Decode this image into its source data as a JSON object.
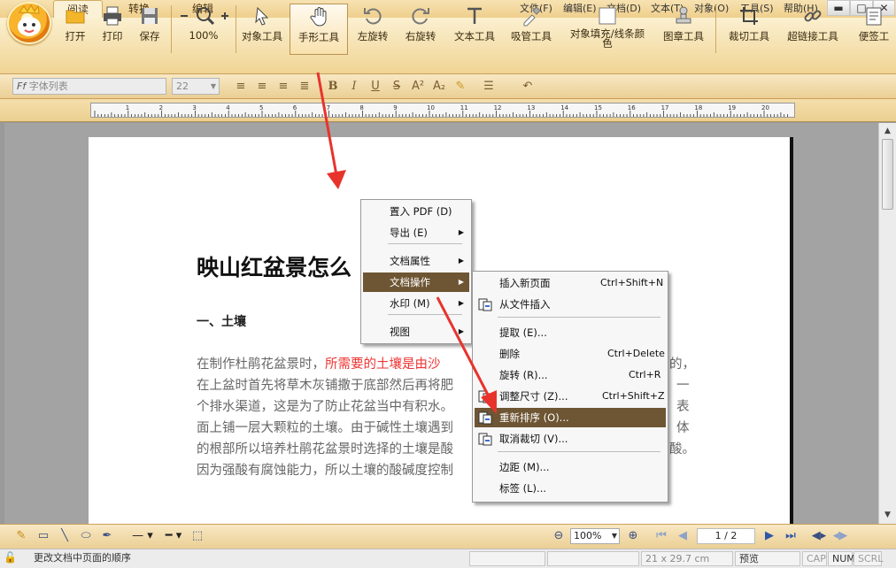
{
  "tabs": [
    {
      "label": "阅读",
      "active": true
    },
    {
      "label": "转换"
    },
    {
      "label": "编辑"
    }
  ],
  "menubar": [
    "文件(F)",
    "编辑(E)",
    "文档(D)",
    "文本(T)",
    "对象(O)",
    "工具(S)",
    "帮助(H)"
  ],
  "window": {
    "minimize": "▬",
    "maximize": "□",
    "close": "✕"
  },
  "toolbar": {
    "open": "打开",
    "print": "打印",
    "save": "保存",
    "zoom": "100%",
    "object_tool": "对象工具",
    "hand_tool": "手形工具",
    "rotate_left": "左旋转",
    "rotate_right": "右旋转",
    "text_tool": "文本工具",
    "eyedropper_tool": "吸管工具",
    "fill_tool_1": "对象填充/线条颜",
    "fill_tool_2": "色",
    "stamp_tool": "图章工具",
    "crop_tool": "裁切工具",
    "hyperlink_tool": "超链接工具",
    "note_tool": "便签工"
  },
  "format": {
    "font_list": "字体列表",
    "font_size": "22"
  },
  "ruler_labels": [
    "1",
    "2",
    "3",
    "4",
    "5",
    "6",
    "7",
    "8",
    "9",
    "10",
    "11",
    "12",
    "13",
    "14",
    "15",
    "16",
    "17",
    "18",
    "19",
    "20"
  ],
  "document": {
    "title": "映山红盆景怎么",
    "heading1": "一、土壤",
    "para_lines": [
      {
        "prefix": "在制作杜鹃花盆景时，",
        "red": "所需要的土壤是由沙",
        "suffix": ""
      },
      {
        "prefix": "在上盆时首先将草木灰铺撒于底部然后再将肥",
        "red": "",
        "suffix": ""
      },
      {
        "prefix": "个排水渠道，这是为了防止花盆当中有积水。",
        "red": "",
        "suffix": ""
      },
      {
        "prefix": "面上铺一层大颗粒的土壤。由于碱性土壤遇到",
        "red": "",
        "suffix": ""
      },
      {
        "prefix": "的根部所以培养杜鹃花盆景时选择的土壤是酸",
        "red": "",
        "suffix": ""
      },
      {
        "prefix": "因为强酸有腐蚀能力，所以土壤的酸碱度控制",
        "red": "",
        "suffix": ""
      }
    ],
    "right_fragments": {
      "r1": "的，",
      "r2": "一",
      "r3": "表",
      "r4": "体",
      "r5": "酸。",
      "r6": ""
    }
  },
  "context_menu": {
    "items": [
      {
        "label": "置入 PDF (D)",
        "submenu": false
      },
      {
        "label": "导出 (E)",
        "submenu": true
      },
      {
        "label": "文档属性",
        "submenu": true
      },
      {
        "label": "文档操作",
        "submenu": true,
        "highlight": true
      },
      {
        "label": "水印 (M)",
        "submenu": true
      },
      {
        "label": "视图",
        "submenu": true
      }
    ]
  },
  "submenu": {
    "items": [
      {
        "label": "插入新页面",
        "shortcut": "Ctrl+Shift+N"
      },
      {
        "label": "从文件插入",
        "shortcut": ""
      },
      {
        "label": "提取 (E)...",
        "shortcut": ""
      },
      {
        "label": "删除",
        "shortcut": "Ctrl+Delete"
      },
      {
        "label": "旋转 (R)...",
        "shortcut": "Ctrl+R"
      },
      {
        "label": "调整尺寸 (Z)...",
        "shortcut": "Ctrl+Shift+Z"
      },
      {
        "label": "重新排序 (O)...",
        "shortcut": "",
        "highlight": true
      },
      {
        "label": "取消裁切 (V)...",
        "shortcut": ""
      },
      {
        "label": "边距 (M)...",
        "shortcut": ""
      },
      {
        "label": "标签 (L)...",
        "shortcut": ""
      }
    ]
  },
  "bottom": {
    "zoom": "100%",
    "page": "1 / 2"
  },
  "status": {
    "message": "更改文档中页面的顺序",
    "size": "21 x 29.7 cm",
    "mode": "预览",
    "cap": "CAP",
    "num": "NUM",
    "scrl": "SCRL"
  },
  "colors": {
    "accent": "#6e5533",
    "toolbar": "#f0d494",
    "arrow": "#e8332c"
  }
}
